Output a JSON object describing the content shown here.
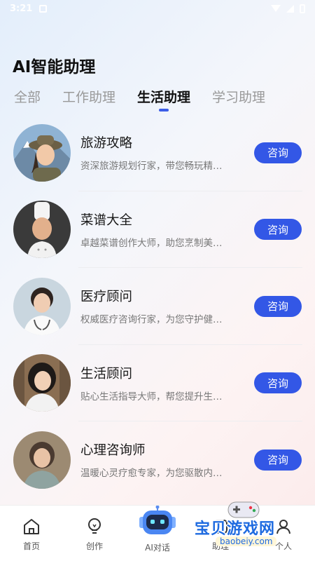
{
  "status_bar": {
    "time": "3:21"
  },
  "header": {
    "title": "AI智能助理"
  },
  "tabs": [
    {
      "label": "全部",
      "active": false
    },
    {
      "label": "工作助理",
      "active": false
    },
    {
      "label": "生活助理",
      "active": true
    },
    {
      "label": "学习助理",
      "active": false
    }
  ],
  "assistants": [
    {
      "name": "旅游攻略",
      "desc": "资深旅游规划行家，带您畅玩精…",
      "button": "咨询",
      "avatar_icon": "traveler-avatar"
    },
    {
      "name": "菜谱大全",
      "desc": "卓越菜谱创作大师，助您烹制美…",
      "button": "咨询",
      "avatar_icon": "chef-avatar"
    },
    {
      "name": "医疗顾问",
      "desc": "权威医疗咨询行家，为您守护健…",
      "button": "咨询",
      "avatar_icon": "doctor-avatar"
    },
    {
      "name": "生活顾问",
      "desc": "贴心生活指导大师，帮您提升生…",
      "button": "咨询",
      "avatar_icon": "life-advisor-avatar"
    },
    {
      "name": "心理咨询师",
      "desc": "温暖心灵疗愈专家，为您驱散内…",
      "button": "咨询",
      "avatar_icon": "psychologist-avatar"
    }
  ],
  "bottom_nav": [
    {
      "label": "首页",
      "icon": "home-icon"
    },
    {
      "label": "创作",
      "icon": "bulb-icon"
    },
    {
      "label": "AI对话",
      "icon": "robot-icon"
    },
    {
      "label": "助理",
      "icon": "assistant-icon"
    },
    {
      "label": "个人",
      "icon": "person-icon"
    }
  ],
  "watermark": {
    "text": "宝贝游戏网",
    "url": "baobeiy.com"
  },
  "colors": {
    "accent": "#3357e6",
    "tab_indicator": "#3b5de7"
  }
}
